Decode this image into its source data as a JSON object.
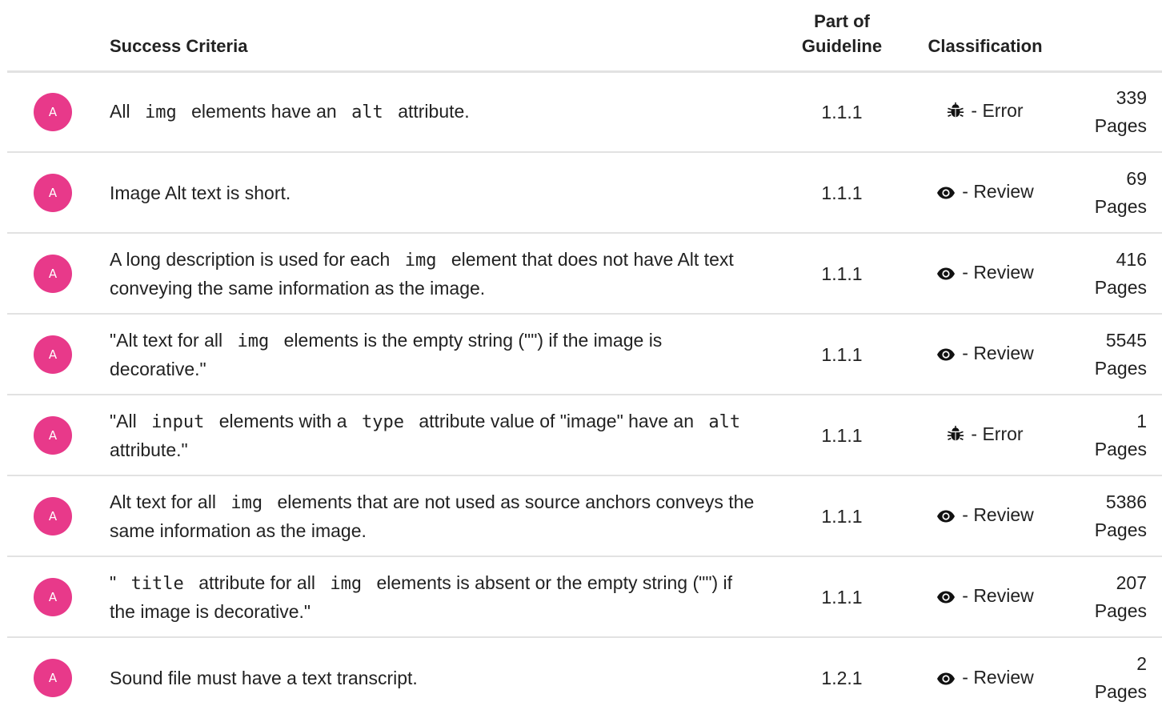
{
  "columns": {
    "success_criteria": "Success Criteria",
    "part_of_guideline": "Part of\nGuideline",
    "classification": "Classification"
  },
  "rows": [
    {
      "level": "A",
      "criteria": [
        {
          "type": "text",
          "text": "All"
        },
        {
          "type": "code",
          "text": "img"
        },
        {
          "type": "text",
          "text": "elements have an"
        },
        {
          "type": "code",
          "text": "alt"
        },
        {
          "type": "text",
          "text": "attribute."
        }
      ],
      "guideline": "1.1.1",
      "classification": {
        "icon": "bug-icon",
        "label": "- Error"
      },
      "pages_count": "339",
      "pages_label": "Pages"
    },
    {
      "level": "A",
      "criteria": [
        {
          "type": "text",
          "text": "Image Alt text is short."
        }
      ],
      "guideline": "1.1.1",
      "classification": {
        "icon": "eye-icon",
        "label": "- Review"
      },
      "pages_count": "69",
      "pages_label": "Pages"
    },
    {
      "level": "A",
      "criteria": [
        {
          "type": "text",
          "text": "A long description is used for each"
        },
        {
          "type": "code",
          "text": "img"
        },
        {
          "type": "text",
          "text": "element that does not have Alt text conveying the same information as the image."
        }
      ],
      "guideline": "1.1.1",
      "classification": {
        "icon": "eye-icon",
        "label": "- Review"
      },
      "pages_count": "416",
      "pages_label": "Pages"
    },
    {
      "level": "A",
      "criteria": [
        {
          "type": "text",
          "text": "\"Alt text for all"
        },
        {
          "type": "code",
          "text": "img"
        },
        {
          "type": "text",
          "text": "elements is the empty string (\"\") if the image is decorative.\""
        }
      ],
      "guideline": "1.1.1",
      "classification": {
        "icon": "eye-icon",
        "label": "- Review"
      },
      "pages_count": "5545",
      "pages_label": "Pages"
    },
    {
      "level": "A",
      "criteria": [
        {
          "type": "text",
          "text": "\"All"
        },
        {
          "type": "code",
          "text": "input"
        },
        {
          "type": "text",
          "text": "elements with a"
        },
        {
          "type": "code",
          "text": "type"
        },
        {
          "type": "text",
          "text": "attribute value of \"image\" have an"
        },
        {
          "type": "code",
          "text": "alt"
        },
        {
          "type": "text",
          "text": "attribute.\""
        }
      ],
      "guideline": "1.1.1",
      "classification": {
        "icon": "bug-icon",
        "label": "- Error"
      },
      "pages_count": "1",
      "pages_label": "Pages"
    },
    {
      "level": "A",
      "criteria": [
        {
          "type": "text",
          "text": "Alt text for all"
        },
        {
          "type": "code",
          "text": "img"
        },
        {
          "type": "text",
          "text": "elements that are not used as source anchors conveys the same information as the image."
        }
      ],
      "guideline": "1.1.1",
      "classification": {
        "icon": "eye-icon",
        "label": "- Review"
      },
      "pages_count": "5386",
      "pages_label": "Pages"
    },
    {
      "level": "A",
      "criteria": [
        {
          "type": "text",
          "text": "\""
        },
        {
          "type": "code",
          "text": "title"
        },
        {
          "type": "text",
          "text": "attribute for all"
        },
        {
          "type": "code",
          "text": "img"
        },
        {
          "type": "text",
          "text": "elements is absent or the empty string (\"\") if the image is decorative.\""
        }
      ],
      "guideline": "1.1.1",
      "classification": {
        "icon": "eye-icon",
        "label": "- Review"
      },
      "pages_count": "207",
      "pages_label": "Pages"
    },
    {
      "level": "A",
      "criteria": [
        {
          "type": "text",
          "text": "Sound file must have a text transcript."
        }
      ],
      "guideline": "1.2.1",
      "classification": {
        "icon": "eye-icon",
        "label": "- Review"
      },
      "pages_count": "2",
      "pages_label": "Pages"
    }
  ]
}
